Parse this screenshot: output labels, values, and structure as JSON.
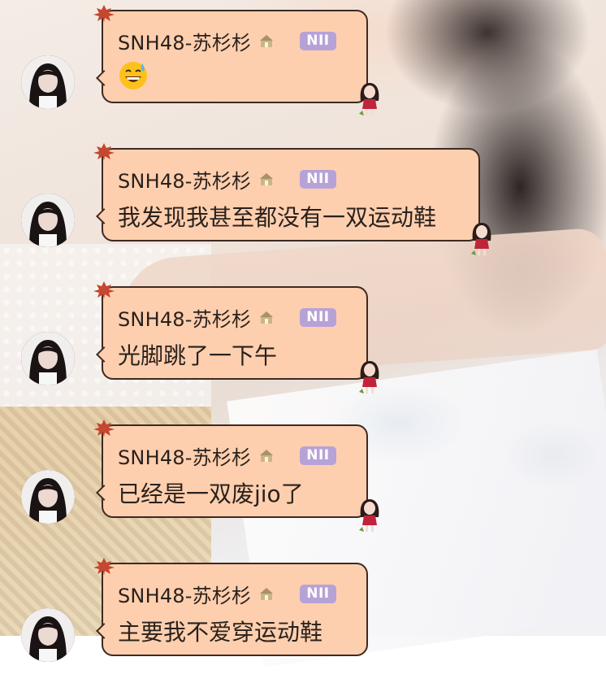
{
  "chat": {
    "messages": [
      {
        "sender": "SNH48-苏杉杉",
        "team": "NII",
        "text": "",
        "emoji": "sweat-smile-emoji"
      },
      {
        "sender": "SNH48-苏杉杉",
        "team": "NII",
        "text": "我发现我甚至都没有一双运动鞋"
      },
      {
        "sender": "SNH48-苏杉杉",
        "team": "NII",
        "text": "光脚跳了一下午"
      },
      {
        "sender": "SNH48-苏杉杉",
        "team": "NII",
        "text": "已经是一双废jio了"
      },
      {
        "sender": "SNH48-苏杉杉",
        "team": "NII",
        "text": "主要我不爱穿运动鞋"
      }
    ]
  },
  "colors": {
    "bubble": "#fecfae",
    "bubble_border": "#3d2a22",
    "badge": "#b7a2d7",
    "text": "#2a211d"
  },
  "icons": {
    "leaf": "maple-leaf-icon",
    "house": "house-badge-icon",
    "sticker": "girl-sticker-icon"
  }
}
